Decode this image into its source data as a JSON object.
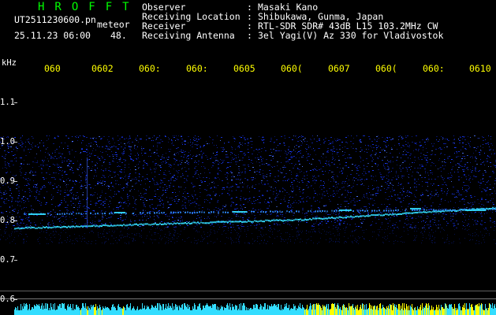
{
  "header": {
    "brand": "HROFFT",
    "filename": "UT2511230600.pn",
    "tag": "meteor",
    "timestamp": "25.11.23 06:00",
    "count": "48.",
    "info": [
      {
        "label": "Observer",
        "sep": ":",
        "value": "Masaki Kano"
      },
      {
        "label": "Receiving Location",
        "sep": ":",
        "value": "Shibukawa, Gunma, Japan"
      },
      {
        "label": "Receiver",
        "sep": ":",
        "value": "RTL-SDR SDR# 43dB L15 103.2MHz CW"
      },
      {
        "label": "Receiving Antenna",
        "sep": ":",
        "value": "3el Yagi(V) Az 330 for Vladivostok"
      }
    ]
  },
  "axis": {
    "unit": "kHz",
    "time_labels": [
      "060",
      "0602",
      "060:",
      "060:",
      "0605",
      "060(",
      "0607",
      "060(",
      "060:",
      "0610"
    ],
    "freq_labels": [
      "1.1",
      "1.0",
      "0.9",
      "0.8",
      "0.7",
      "0.6"
    ]
  },
  "colors": {
    "background": "#000000",
    "text_green": "#00ff00",
    "text_white": "#ffffff",
    "text_yellow": "#ffff00",
    "noise_blue": "#1a3cff",
    "carrier_cyan": "#33ddff",
    "meteor_yellow": "#ffff00"
  }
}
